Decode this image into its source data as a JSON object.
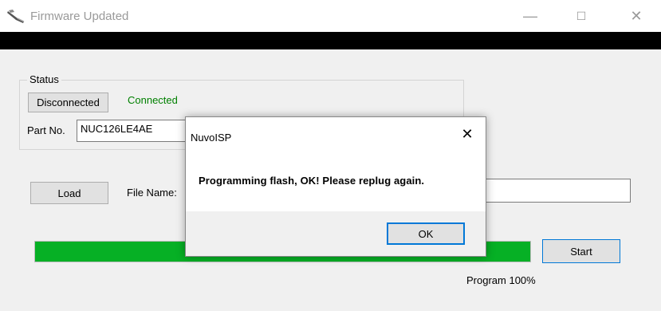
{
  "window": {
    "title": "Firmware Updated",
    "minimize_glyph": "—",
    "maximize_glyph": "☐",
    "close_glyph": "✕"
  },
  "status": {
    "group_label": "Status",
    "disconnected_button": "Disconnected",
    "connected_text": "Connected",
    "connected_color": "#008000"
  },
  "part": {
    "label": "Part No.",
    "value": "NUC126LE4AE"
  },
  "file": {
    "load_button": "Load",
    "name_label": "File Name:",
    "name_value": ""
  },
  "progress": {
    "fraction": 1.0,
    "fill_color": "#06b025",
    "status_text": "Program 100%",
    "start_button": "Start"
  },
  "dialog": {
    "title": "NuvoISP",
    "close_glyph": "✕",
    "message": "Programming flash, OK! Please replug again.",
    "ok_button": "OK"
  }
}
